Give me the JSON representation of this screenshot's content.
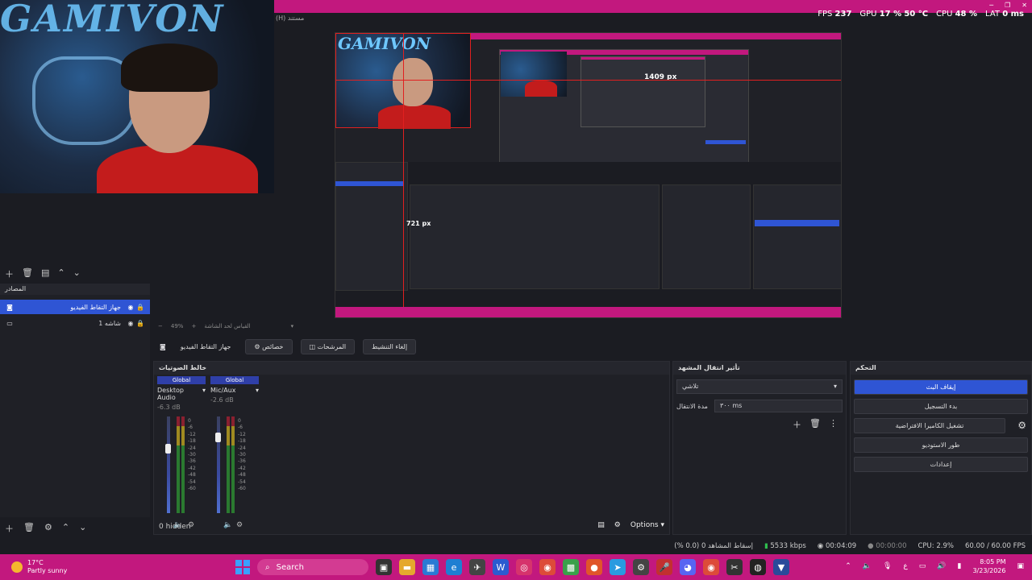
{
  "topbar": {
    "hint": "(H) مستند"
  },
  "stats": {
    "fps_label": "FPS",
    "fps_value": "237",
    "gpu_label": "GPU",
    "gpu_value": "17 %",
    "gpu_temp": "50 °C",
    "cpu_label": "CPU",
    "cpu_value": "48 %",
    "lat_label": "LAT",
    "lat_value": "0 ms"
  },
  "preview": {
    "size_label_w": "1409 px",
    "size_label_h": "721 px",
    "webcam_logo": "GAMIVON"
  },
  "webcam": {
    "logo": "GAMIVON"
  },
  "sources": {
    "title": "المصادر",
    "items": [
      {
        "name": "جهاز التقاط الفيديو"
      },
      {
        "name": "شاشه 1"
      }
    ]
  },
  "zoom": {
    "value": "49%",
    "hint": "القياس لحد الشاشة"
  },
  "source_toolbar": {
    "source_name": "جهاز التقاط الفيديو",
    "properties": "خصائص",
    "filters": "المرشحات",
    "deactivate": "إلغاء التنشيط"
  },
  "mixer": {
    "title": "خالط الصوتيات",
    "channels": [
      {
        "badge": "Global",
        "name": "Desktop Audio",
        "db": "-6.3 dB"
      },
      {
        "badge": "Global",
        "name": "Mic/Aux",
        "db": "-2.6 dB"
      }
    ],
    "scale": [
      "0",
      "-6",
      "-12",
      "-18",
      "-24",
      "-30",
      "-36",
      "-42",
      "-48",
      "-54",
      "-60"
    ],
    "hidden": "0 hidden",
    "options": "Options"
  },
  "transitions": {
    "title": "تأثير انتقال المشهد",
    "selected": "تلاشي",
    "duration_label": "مدة الانتقال",
    "duration_value": "٣٠٠ ms"
  },
  "controls": {
    "title": "التحكم",
    "stop_stream": "إيقاف البث",
    "start_record": "بدء التسجيل",
    "virtual_cam": "تشغيل الكاميرا الافتراضية",
    "studio_mode": "طور الاستوديو",
    "settings": "إعدادات"
  },
  "status": {
    "dropped": "إسقاط المشاهد 0 (0.0 %)",
    "bitrate": "5533 kbps",
    "stream_time": "00:04:09",
    "rec_time": "00:00:00",
    "cpu": "CPU: 2.9%",
    "fps": "60.00 / 60.00 FPS"
  },
  "taskbar": {
    "weather_temp": "17°C",
    "weather_desc": "Partly sunny",
    "search": "Search",
    "time": "8:05 PM",
    "date": "3/23/2026",
    "lang": "ع"
  },
  "colors": {
    "accent": "#c2187e",
    "selection": "#2f55d4",
    "panel": "#1f2026"
  }
}
